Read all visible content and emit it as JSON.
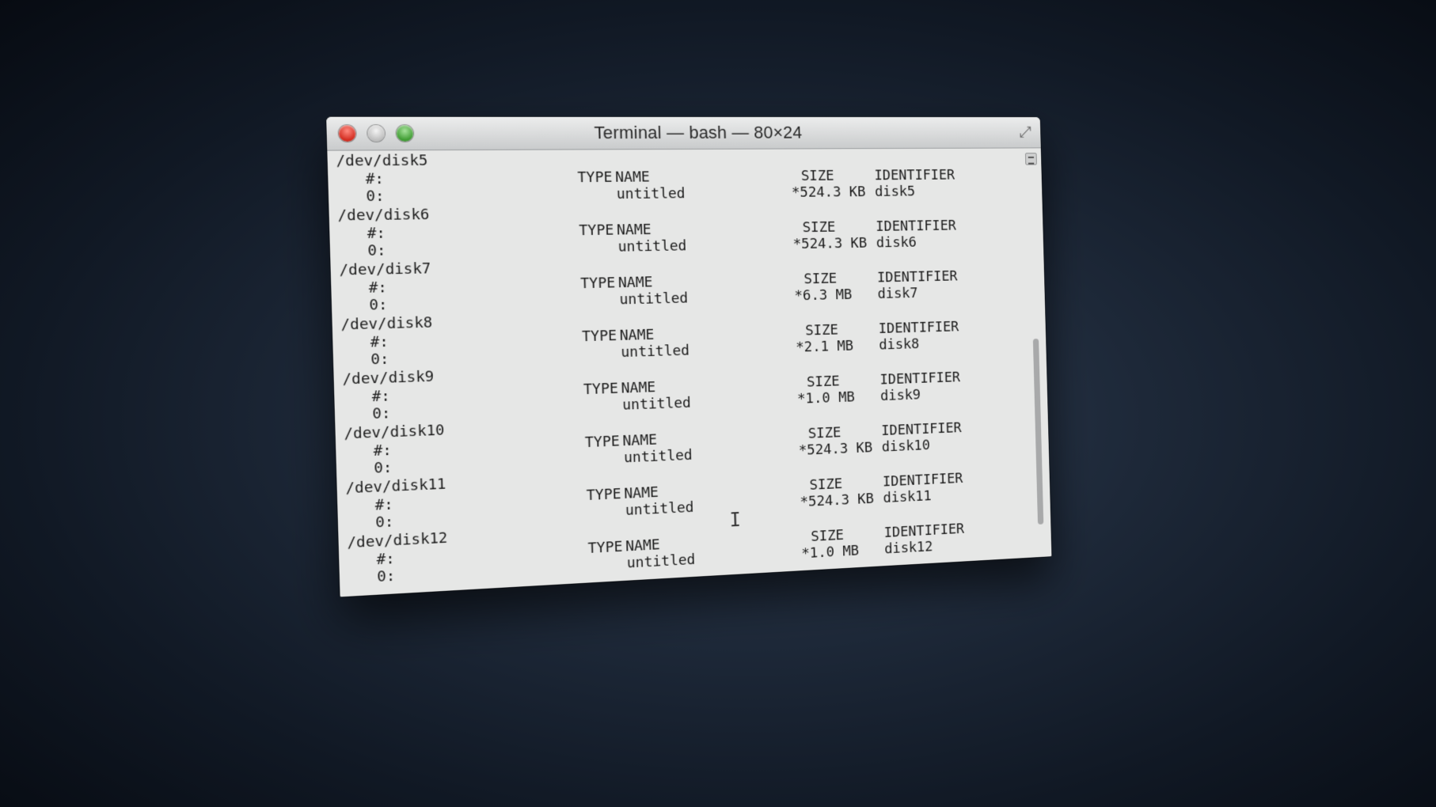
{
  "window": {
    "title": "Terminal — bash — 80×24"
  },
  "terminal": {
    "header": {
      "hash": "#:",
      "type": "TYPE",
      "name": "NAME",
      "size": "SIZE",
      "identifier": "IDENTIFIER"
    },
    "row_index": "0:",
    "disks": [
      {
        "path": "/dev/disk5",
        "name": "untitled",
        "size": "*524.3 KB",
        "identifier": "disk5"
      },
      {
        "path": "/dev/disk6",
        "name": "untitled",
        "size": "*524.3 KB",
        "identifier": "disk6"
      },
      {
        "path": "/dev/disk7",
        "name": "untitled",
        "size": "*6.3 MB",
        "identifier": "disk7"
      },
      {
        "path": "/dev/disk8",
        "name": "untitled",
        "size": "*2.1 MB",
        "identifier": "disk8"
      },
      {
        "path": "/dev/disk9",
        "name": "untitled",
        "size": "*1.0 MB",
        "identifier": "disk9"
      },
      {
        "path": "/dev/disk10",
        "name": "untitled",
        "size": "*524.3 KB",
        "identifier": "disk10"
      },
      {
        "path": "/dev/disk11",
        "name": "untitled",
        "size": "*524.3 KB",
        "identifier": "disk11"
      },
      {
        "path": "/dev/disk12",
        "name": "untitled",
        "size": "*1.0 MB",
        "identifier": "disk12"
      }
    ]
  },
  "icons": {
    "close": "close-icon",
    "minimize": "minimize-icon",
    "zoom": "zoom-icon",
    "fullscreen": "fullscreen-icon",
    "split": "split-view-icon",
    "cursor": "text-cursor-icon"
  }
}
